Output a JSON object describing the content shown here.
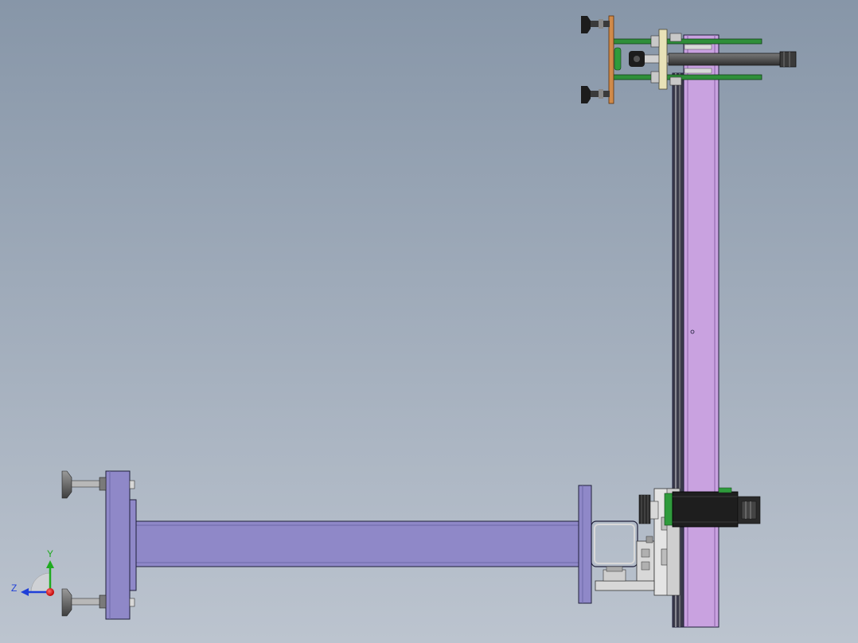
{
  "view": {
    "background_top": "#8796a8",
    "background_bottom": "#bcc4cf"
  },
  "colors": {
    "beam_fill": "#8f88c8",
    "beam_dark": "#6e67a8",
    "column_fill": "#c9a2e0",
    "column_edge": "#8a63a8",
    "plate_orange": "#d08a4a",
    "guide_rod_green": "#2f8f3a",
    "cylinder_gray": "#5a5a5a",
    "cylinder_dark": "#2b2b2b",
    "cup_black": "#1c1c1c",
    "bracket_cream": "#e8e2b8",
    "motor_black": "#1e1e1e",
    "motor_green": "#2f9b3c",
    "metal_light": "#d8d8d8",
    "metal_mid": "#a8a8a8",
    "foot_gray": "#6a6a6a",
    "outline": "#1f1f3a"
  },
  "triad": {
    "y_label": "Y",
    "z_label": "Z",
    "y_color": "#1faa1f",
    "z_color": "#1f3fd8",
    "x_dot_color": "#e01a1a"
  },
  "icons": {
    "orientation_triad": "xyz-axis-triad-icon"
  }
}
